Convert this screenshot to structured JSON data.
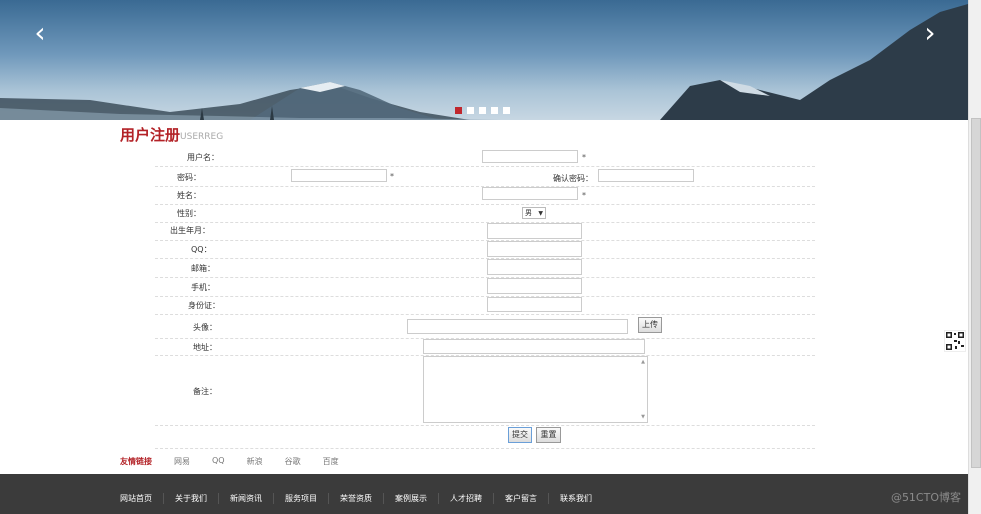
{
  "banner": {
    "prev_icon": "chevron-left-icon",
    "next_icon": "chevron-right-icon",
    "prev_glyph": "‹",
    "next_glyph": "›",
    "active_slide": 1,
    "slide_count": 5,
    "accent_color": "#c0272d"
  },
  "title": {
    "cn": "用户注册",
    "en": "USERREG"
  },
  "form": {
    "username_label": "用户名：",
    "password_label": "密码：",
    "confirm_label": "确认密码：",
    "name_label": "姓名：",
    "gender_label": "性别：",
    "gender_value": "男",
    "birth_label": "出生年月：",
    "qq_label": "QQ：",
    "email_label": "邮箱：",
    "phone_label": "手机：",
    "id_label": "身份证：",
    "avatar_label": "头像：",
    "upload_label": "上传",
    "address_label": "地址：",
    "remark_label": "备注：",
    "submit_label": "提交",
    "reset_label": "重置",
    "required_mark": "*"
  },
  "friend_links": {
    "title": "友情链接",
    "items": [
      "网易",
      "QQ",
      "新浪",
      "谷歌",
      "百度"
    ]
  },
  "footer": {
    "nav": [
      "网站首页",
      "关于我们",
      "新闻资讯",
      "服务项目",
      "荣誉资质",
      "案例展示",
      "人才招聘",
      "客户留言",
      "联系我们"
    ]
  },
  "watermark": "@51CTO博客"
}
